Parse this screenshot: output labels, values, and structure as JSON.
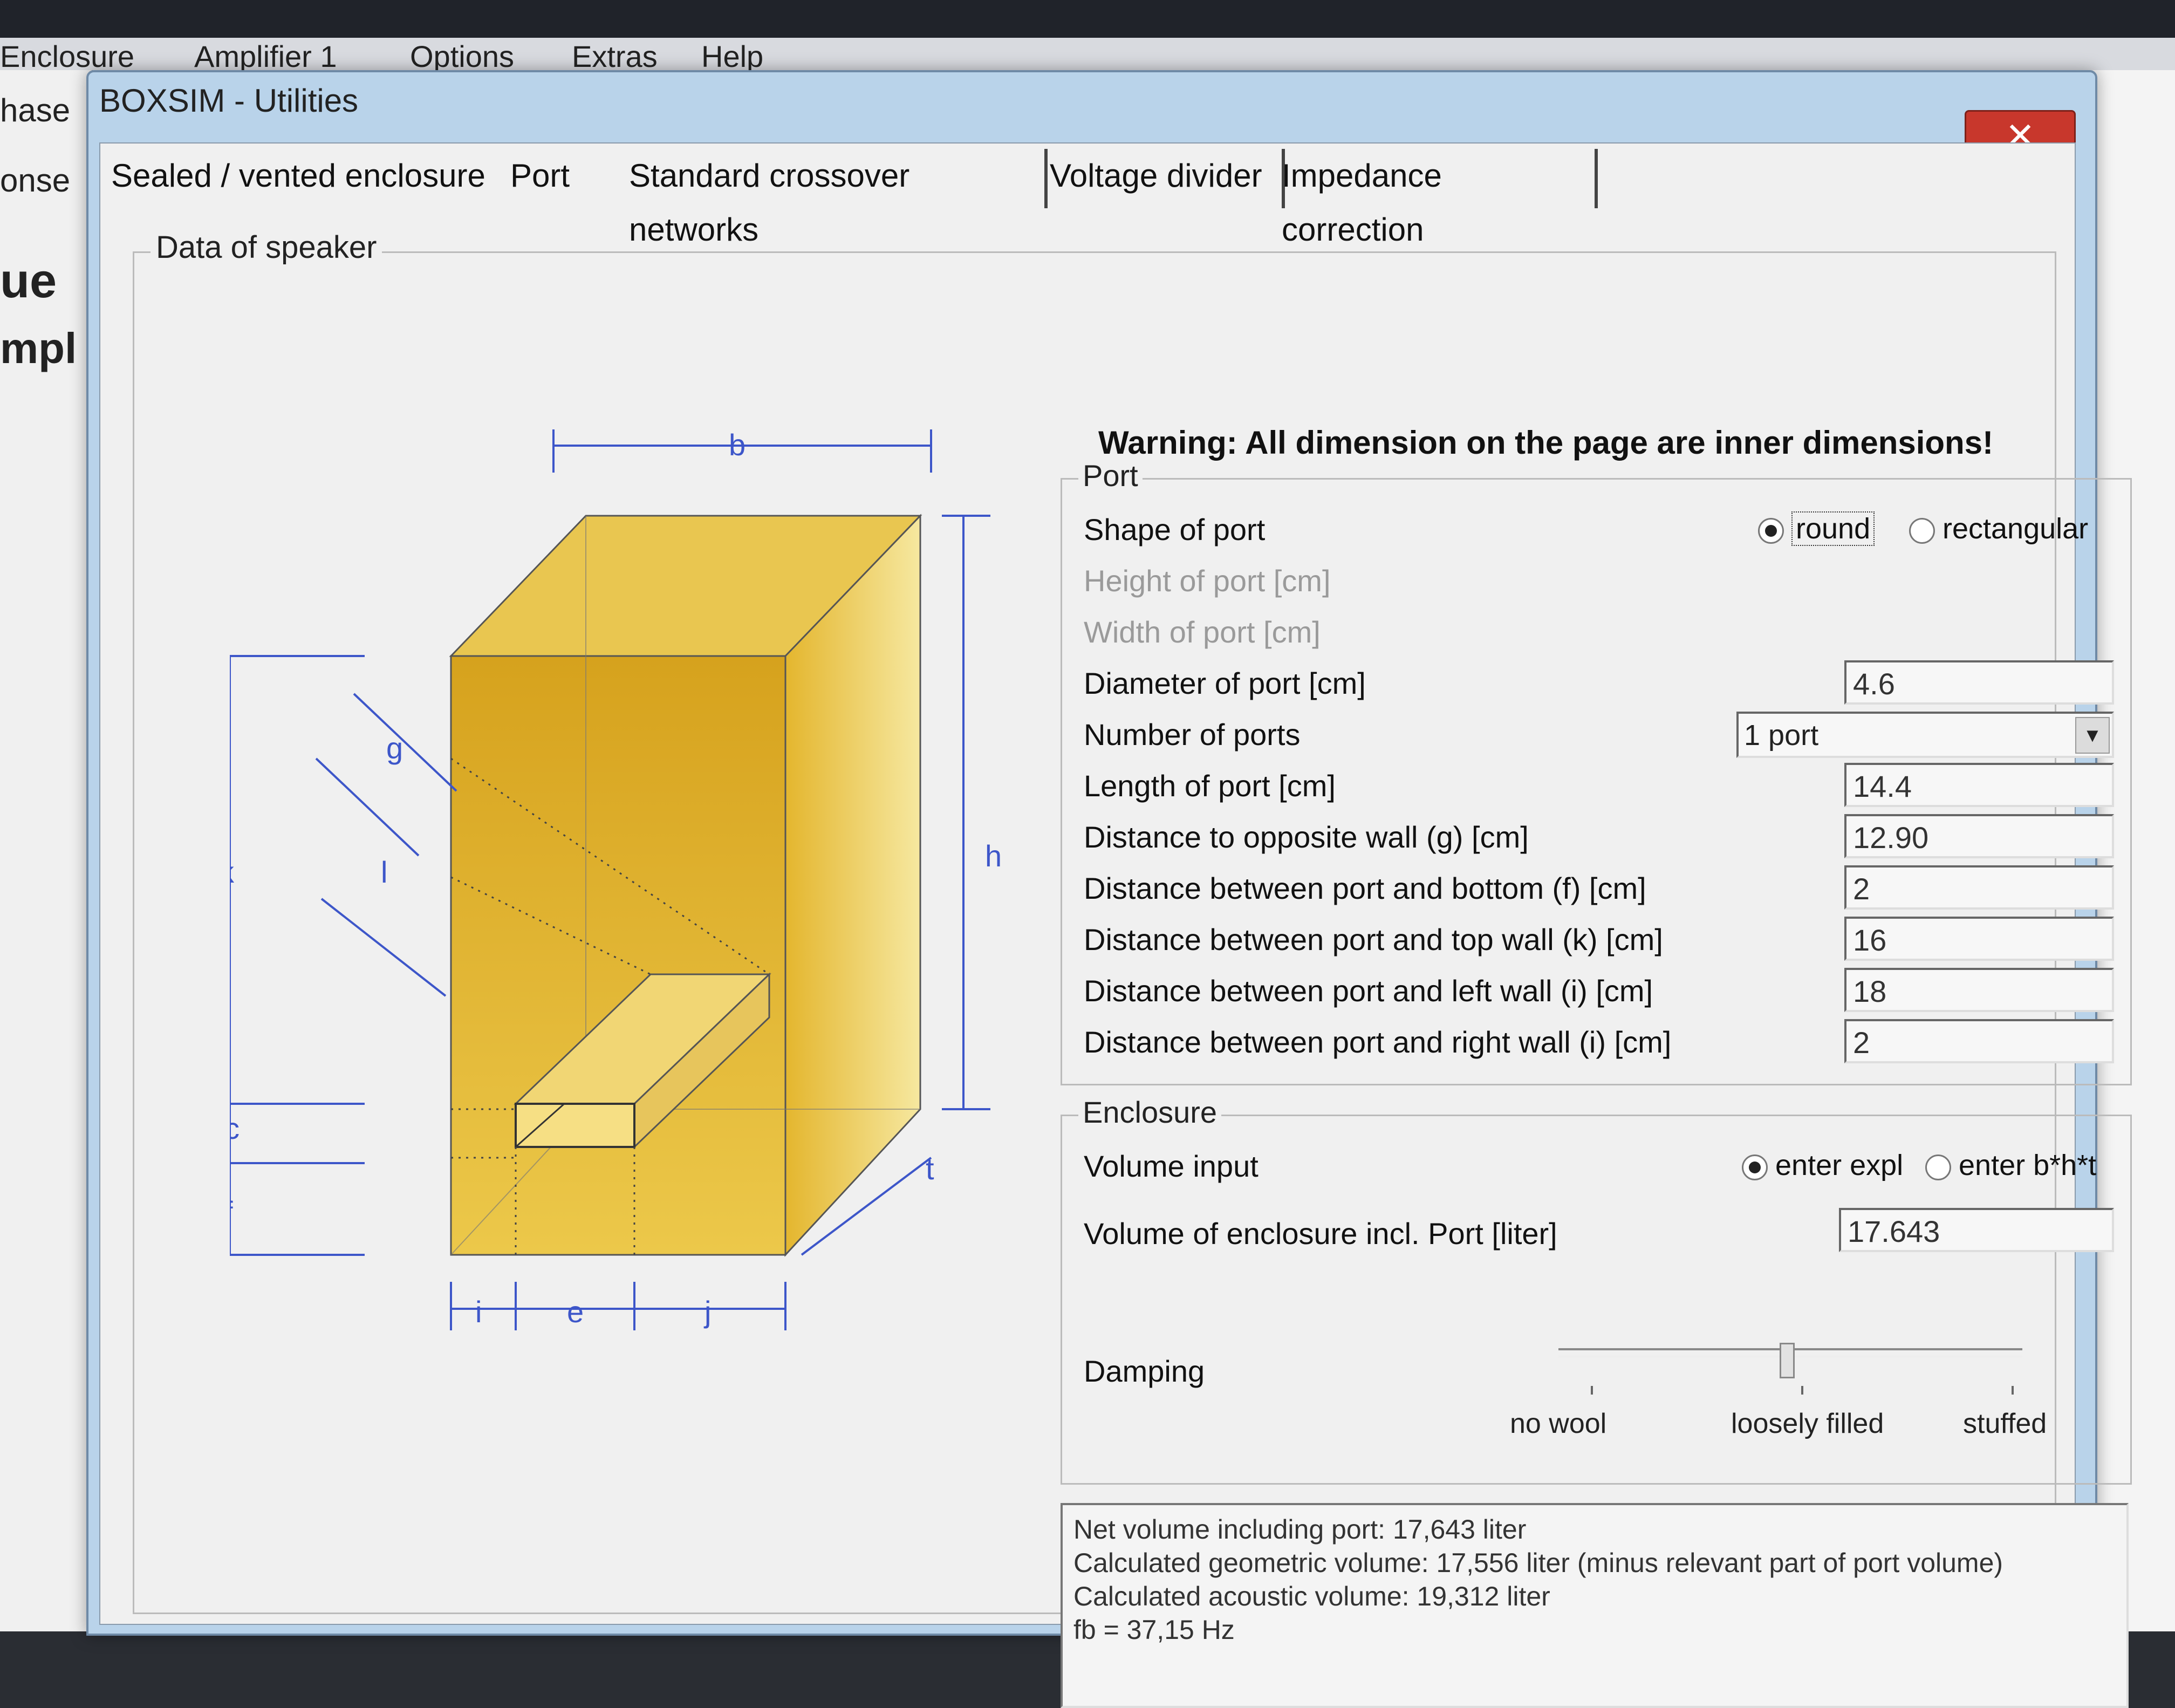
{
  "background_app": {
    "menu_items": [
      "Enclosure",
      "Amplifier 1",
      "Options",
      "Extras",
      "Help"
    ],
    "left_labels": [
      "hase",
      "onse",
      "ue",
      "mpl"
    ]
  },
  "window": {
    "title": "BOXSIM - Utilities",
    "close_label": "✕"
  },
  "tabs": [
    {
      "label": "Sealed / vented enclosure"
    },
    {
      "label": "Port"
    },
    {
      "label": "Standard crossover networks"
    },
    {
      "label": "Voltage divider"
    },
    {
      "label": "Impedance correction"
    }
  ],
  "speaker_group": {
    "legend": "Data of speaker"
  },
  "diagram": {
    "labels": {
      "b": "b",
      "h": "h",
      "g": "g",
      "l": "l",
      "k": "k",
      "c": "c",
      "f": "f",
      "t": "t",
      "i": "i",
      "e": "e",
      "j": "j"
    },
    "box_color": "#e0b73a"
  },
  "warning": "Warning: All dimension on the page are inner dimensions!",
  "port": {
    "legend": "Port",
    "shape_label": "Shape of port",
    "shape_options": [
      "round",
      "rectangular"
    ],
    "shape_selected": "round",
    "height_label": "Height of port [cm]",
    "width_label": "Width of port [cm]",
    "diameter_label": "Diameter of port [cm]",
    "diameter_value": "4.6",
    "number_label": "Number of ports",
    "number_value": "1 port",
    "length_label": "Length of port [cm]",
    "length_value": "14.4",
    "opposite_label": "Distance to opposite wall (g) [cm]",
    "opposite_value": "12.90",
    "bottom_label": "Distance between port and bottom (f) [cm]",
    "bottom_value": "2",
    "top_label": "Distance between port and top wall (k) [cm]",
    "top_value": "16",
    "left_label": "Distance between port and left wall (i) [cm]",
    "left_value": "18",
    "right_label": "Distance between port and right wall (i) [cm]",
    "right_value": "2"
  },
  "enclosure": {
    "legend": "Enclosure",
    "volume_input_label": "Volume input",
    "volume_options": [
      "enter expl",
      "enter b*h*t"
    ],
    "volume_selected": "enter expl",
    "volume_label": "Volume of enclosure incl. Port [liter]",
    "volume_value": "17.643",
    "damping_label": "Damping",
    "damping_ticks": [
      "no wool",
      "loosely filled",
      "stuffed"
    ],
    "damping_level": 0.5
  },
  "results": [
    "Net volume including port: 17,643 liter",
    "Calculated geometric volume: 17,556 liter (minus relevant part of port volume)",
    "Calculated acoustic volume: 19,312 liter",
    "fb = 37,15 Hz"
  ]
}
